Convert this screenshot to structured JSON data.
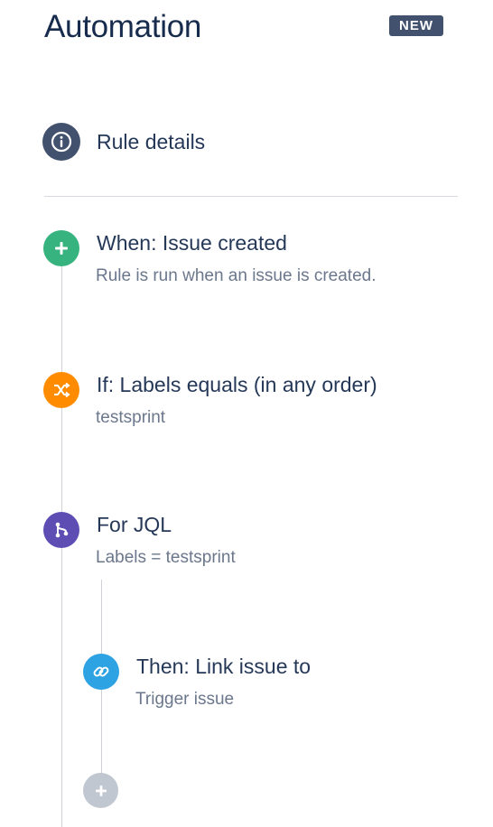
{
  "header": {
    "title": "Automation",
    "badge": "NEW"
  },
  "rule_details": {
    "label": "Rule details",
    "icon": "info-icon",
    "color": "#42526e"
  },
  "components": [
    {
      "type": "trigger",
      "heading": "When: Issue created",
      "description": "Rule is run when an issue is created.",
      "icon": "plus-icon",
      "color": "#36b37e"
    },
    {
      "type": "condition",
      "heading": "If: Labels equals (in any order)",
      "description": "testsprint",
      "icon": "shuffle-icon",
      "color": "#ff8b00"
    },
    {
      "type": "branch",
      "heading": "For JQL",
      "description": "Labels = testsprint",
      "icon": "branch-icon",
      "color": "#5e4db2"
    },
    {
      "type": "action",
      "heading": "Then: Link issue to",
      "description": "Trigger issue",
      "icon": "link-icon",
      "color": "#2ea3e3"
    }
  ],
  "add_component": {
    "icon": "plus-icon",
    "color": "#c1c7d0"
  }
}
